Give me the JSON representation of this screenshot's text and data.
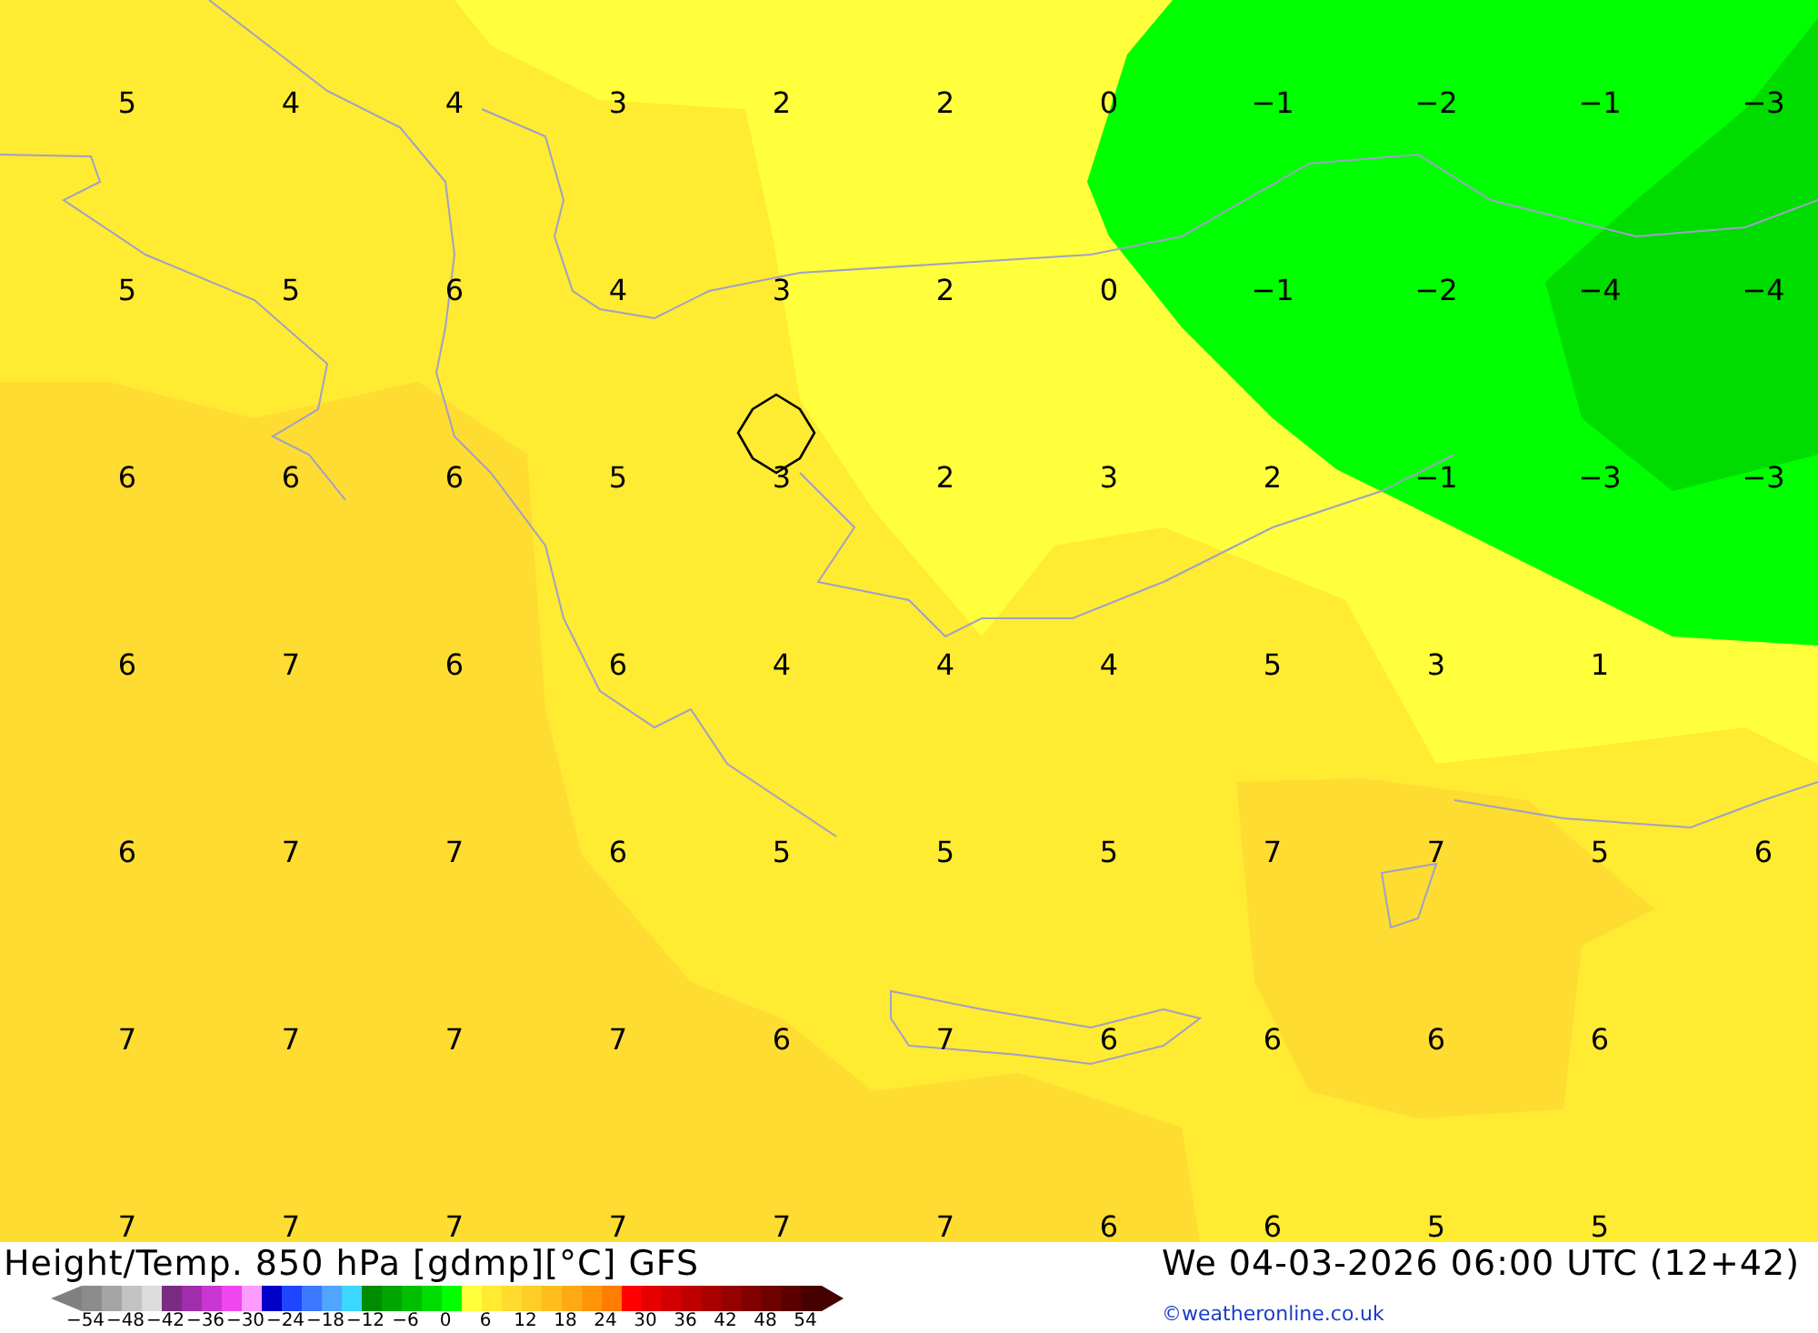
{
  "map": {
    "value_rows": [
      [
        "5",
        "4",
        "4",
        "3",
        "2",
        "2",
        "0",
        "−1",
        "−2",
        "−1",
        "−3"
      ],
      [
        "5",
        "5",
        "6",
        "4",
        "3",
        "2",
        "0",
        "−1",
        "−2",
        "−4",
        "−4"
      ],
      [
        "6",
        "6",
        "6",
        "5",
        "3",
        "2",
        "3",
        "2",
        "−1",
        "−3",
        "−3"
      ],
      [
        "6",
        "7",
        "6",
        "6",
        "4",
        "4",
        "4",
        "5",
        "3",
        "1",
        null
      ],
      [
        "6",
        "7",
        "7",
        "6",
        "5",
        "5",
        "5",
        "7",
        "7",
        "5",
        "6"
      ],
      [
        "7",
        "7",
        "7",
        "7",
        "6",
        "7",
        "6",
        "6",
        "6",
        "6",
        null
      ],
      [
        "7",
        "7",
        "7",
        "7",
        "7",
        "7",
        "6",
        "6",
        "5",
        "5",
        null
      ]
    ]
  },
  "footer": {
    "title": "Height/Temp. 850 hPa [gdmp][°C] GFS",
    "datetime": "We 04-03-2026 06:00 UTC (12+42)",
    "credit": "©weatheronline.co.uk",
    "legend": {
      "swatches": [
        {
          "color": "#8c8c8c"
        },
        {
          "color": "#a5a5a5"
        },
        {
          "color": "#c3c3c3"
        },
        {
          "color": "#dcdcdc"
        },
        {
          "color": "#782d82"
        },
        {
          "color": "#a02daa"
        },
        {
          "color": "#c837d2"
        },
        {
          "color": "#f046f0"
        },
        {
          "color": "#ff9bff"
        },
        {
          "color": "#0000c8"
        },
        {
          "color": "#1e46ff"
        },
        {
          "color": "#3c78ff"
        },
        {
          "color": "#50a5ff"
        },
        {
          "color": "#3cd7ff"
        },
        {
          "color": "#008c00"
        },
        {
          "color": "#00a500"
        },
        {
          "color": "#00be00"
        },
        {
          "color": "#00dc00"
        },
        {
          "color": "#00ff00"
        },
        {
          "color": "#ffff3c"
        },
        {
          "color": "#ffeb32"
        },
        {
          "color": "#ffdc2d"
        },
        {
          "color": "#ffcd28"
        },
        {
          "color": "#ffbe1e"
        },
        {
          "color": "#ffaa14"
        },
        {
          "color": "#ff960a"
        },
        {
          "color": "#ff7d00"
        },
        {
          "color": "#ff0000"
        },
        {
          "color": "#e60000"
        },
        {
          "color": "#d20000"
        },
        {
          "color": "#be0000"
        },
        {
          "color": "#aa0000"
        },
        {
          "color": "#960000"
        },
        {
          "color": "#820000"
        },
        {
          "color": "#6e0000"
        },
        {
          "color": "#5a0000"
        },
        {
          "color": "#460000"
        }
      ],
      "ticks": [
        "−54",
        "−48",
        "−42",
        "−36",
        "−30",
        "−24",
        "−18",
        "−12",
        "−6",
        "0",
        "6",
        "12",
        "18",
        "24",
        "30",
        "36",
        "42",
        "48",
        "54"
      ]
    }
  }
}
